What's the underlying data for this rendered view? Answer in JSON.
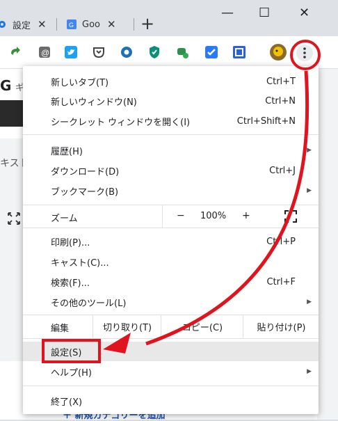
{
  "tabs": [
    {
      "label": "設定",
      "close": "✕"
    },
    {
      "label": "Goo",
      "close": "✕"
    }
  ],
  "new_tab": "+",
  "window_controls": {
    "minimize": "—",
    "maximize": "☐",
    "close": "✕"
  },
  "page": {
    "logo_letter": "G",
    "logo_text": "ギ",
    "side_text": "キスト",
    "bottom_link": "＋ 新規カテゴリーを追加"
  },
  "menu": {
    "new_tab": {
      "label": "新しいタブ(T)",
      "shortcut": "Ctrl+T"
    },
    "new_window": {
      "label": "新しいウィンドウ(N)",
      "shortcut": "Ctrl+N"
    },
    "incognito": {
      "label": "シークレット ウィンドウを開く(I)",
      "shortcut": "Ctrl+Shift+N"
    },
    "history": {
      "label": "履歴(H)"
    },
    "downloads": {
      "label": "ダウンロード(D)",
      "shortcut": "Ctrl+J"
    },
    "bookmarks": {
      "label": "ブックマーク(B)"
    },
    "zoom": {
      "label": "ズーム",
      "minus": "−",
      "value": "100%",
      "plus": "+",
      "fullscreen": "⛶"
    },
    "print": {
      "label": "印刷(P)...",
      "shortcut": "Ctrl+P"
    },
    "cast": {
      "label": "キャスト(C)..."
    },
    "find": {
      "label": "検索(F)...",
      "shortcut": "Ctrl+F"
    },
    "more_tools": {
      "label": "その他のツール(L)"
    },
    "edit": {
      "label": "編集",
      "cut": "切り取り(T)",
      "copy": "コピー(C)",
      "paste": "貼り付け(P)"
    },
    "settings": {
      "label": "設定(S)"
    },
    "help": {
      "label": "ヘルプ(H)"
    },
    "exit": {
      "label": "終了(X)"
    }
  },
  "annotation_color": "#e0141e"
}
